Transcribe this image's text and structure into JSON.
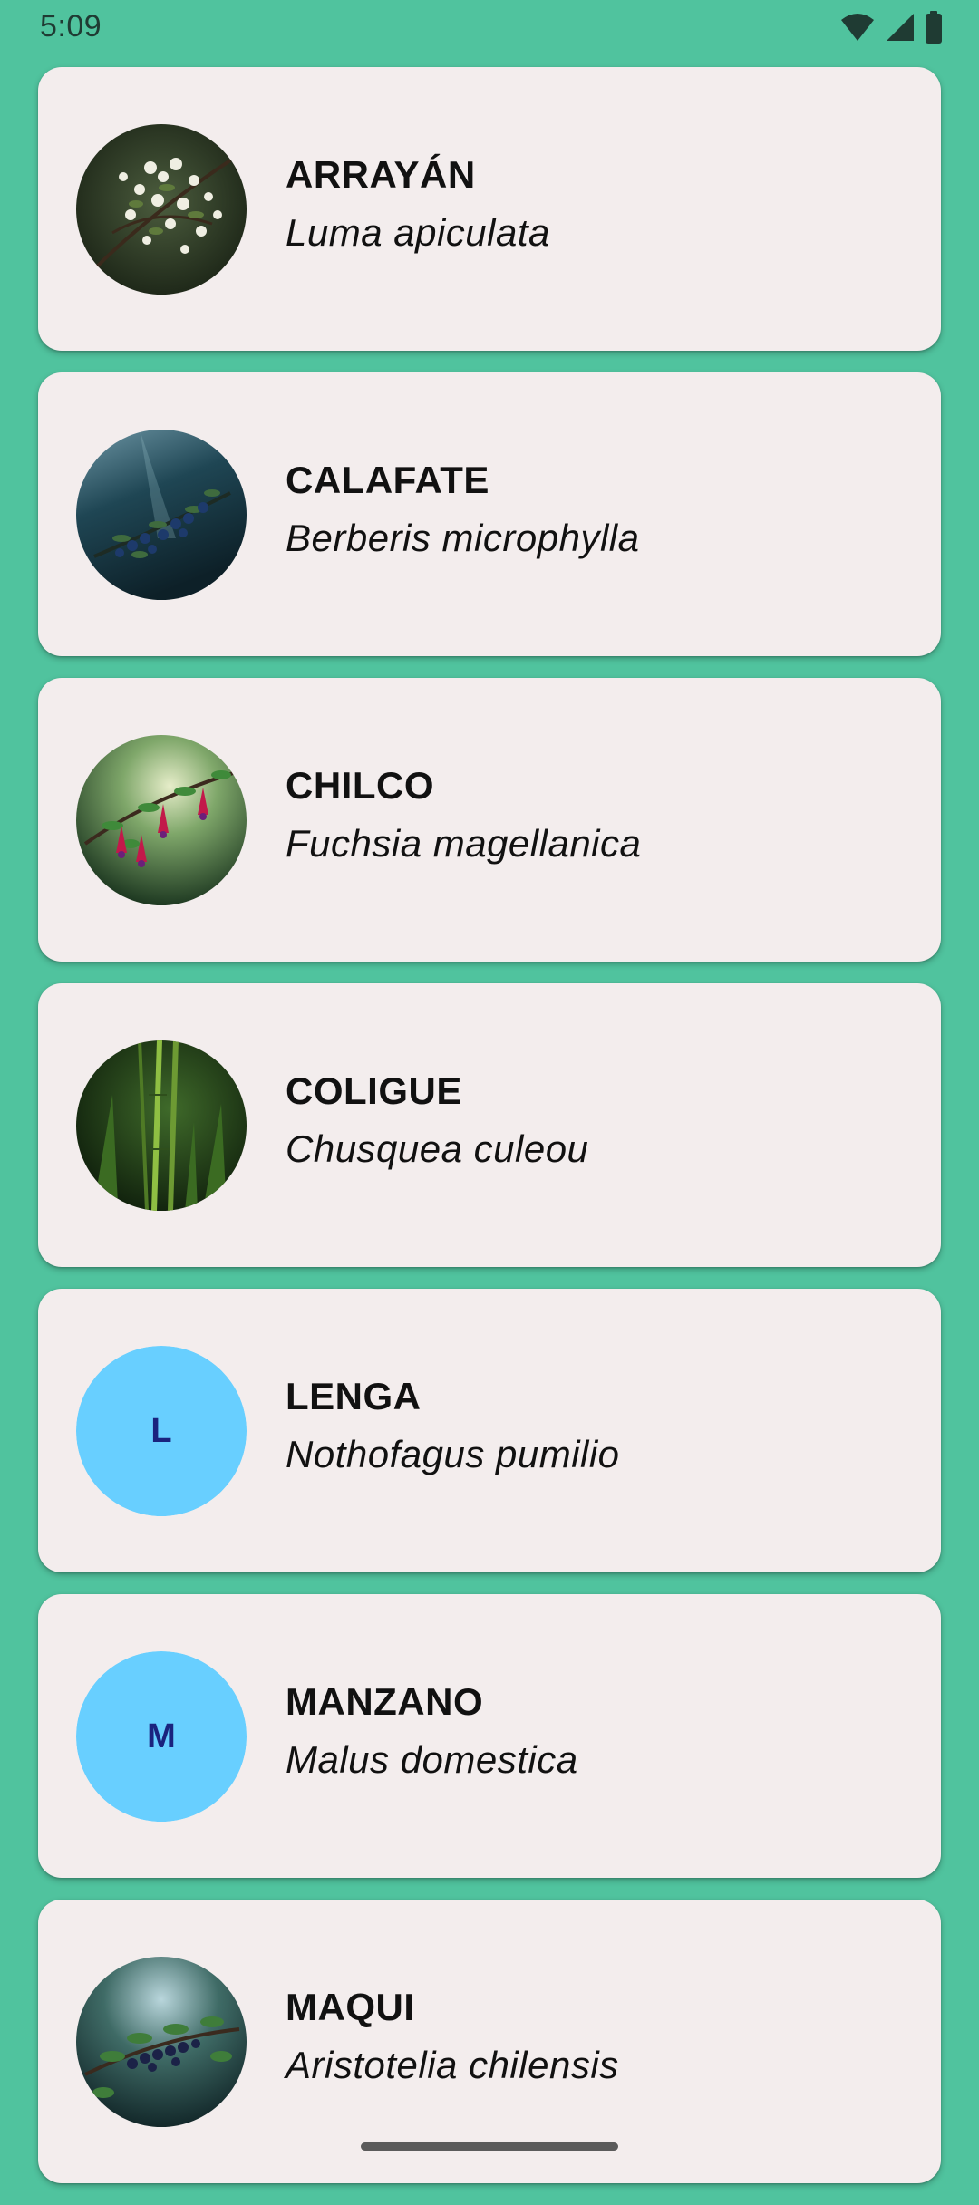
{
  "status_bar": {
    "time": "5:09",
    "icons": [
      "wifi-icon",
      "cell-signal-icon",
      "battery-icon"
    ]
  },
  "plants": [
    {
      "common_name": "ARRAYÁN",
      "scientific_name": "Luma apiculata",
      "thumbnail": "white-flowers-photo"
    },
    {
      "common_name": "CALAFATE",
      "scientific_name": "Berberis microphylla",
      "thumbnail": "blue-berries-photo"
    },
    {
      "common_name": "CHILCO",
      "scientific_name": "Fuchsia magellanica",
      "thumbnail": "red-fuchsia-flowers-photo"
    },
    {
      "common_name": "COLIGUE",
      "scientific_name": "Chusquea culeou",
      "thumbnail": "bamboo-stems-photo"
    },
    {
      "common_name": "LENGA",
      "scientific_name": "Nothofagus pumilio",
      "thumbnail": "letter-avatar",
      "avatar_letter": "L"
    },
    {
      "common_name": "MANZANO",
      "scientific_name": "Malus domestica",
      "thumbnail": "letter-avatar",
      "avatar_letter": "M"
    },
    {
      "common_name": "MAQUI",
      "scientific_name": "Aristotelia chilensis",
      "thumbnail": "dark-berries-photo"
    }
  ],
  "colors": {
    "background": "#50C39E",
    "card": "#F3EDED",
    "avatar_fallback": "#68CFFF",
    "avatar_letter": "#1A237E"
  }
}
